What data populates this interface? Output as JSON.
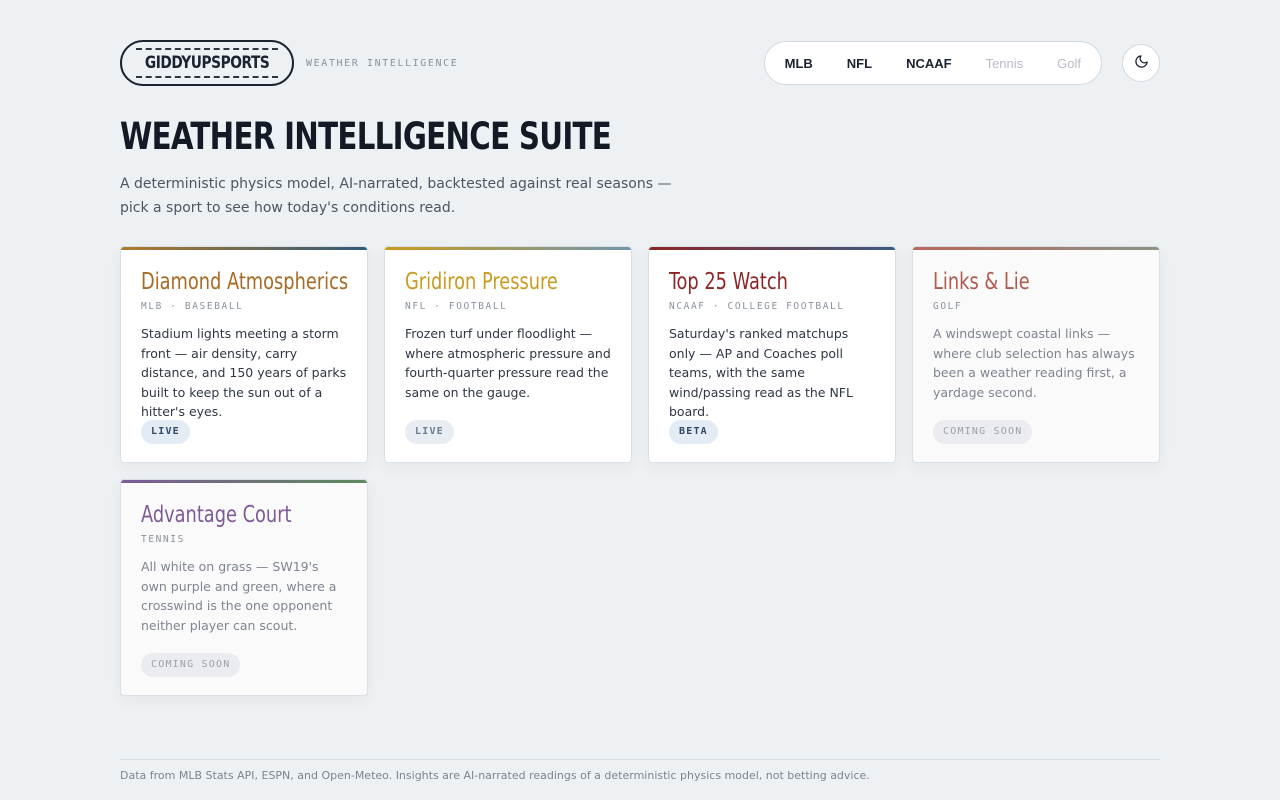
{
  "brand": {
    "logo_text": "GIDDYUPSPORTS",
    "tagline": "WEATHER INTELLIGENCE"
  },
  "nav": {
    "items": [
      {
        "label": "MLB",
        "disabled": false
      },
      {
        "label": "NFL",
        "disabled": false
      },
      {
        "label": "NCAAF",
        "disabled": false
      },
      {
        "label": "Tennis",
        "disabled": true
      },
      {
        "label": "Golf",
        "disabled": true
      }
    ],
    "theme_icon": "moon-icon"
  },
  "hero": {
    "title": "WEATHER INTELLIGENCE SUITE",
    "subtitle": "A deterministic physics model, AI-narrated, backtested against real seasons — pick a sport to see how today's conditions read."
  },
  "cards": [
    {
      "title": "Diamond Atmospherics",
      "meta": "MLB · BASEBALL",
      "description": "Stadium lights meeting a storm front — air density, carry distance, and 150 years of parks built to keep the sun out of a hitter's eyes.",
      "badge": "LIVE",
      "title_color": "#a86a23",
      "accent_from": "#b07a2a",
      "accent_to": "#2f5a7a"
    },
    {
      "title": "Gridiron Pressure",
      "meta": "NFL · FOOTBALL",
      "description": "Frozen turf under floodlight — where atmospheric pressure and fourth-quarter pressure read the same on the gauge.",
      "badge": "LIVE",
      "title_color": "#c99a1e",
      "accent_from": "#c99a1e",
      "accent_to": "#6f97ad"
    },
    {
      "title": "Top 25 Watch",
      "meta": "NCAAF · COLLEGE FOOTBALL",
      "description": "Saturday's ranked matchups only — AP and Coaches poll teams, with the same wind/passing read as the NFL board.",
      "badge": "BETA",
      "title_color": "#8c2626",
      "accent_from": "#8c2626",
      "accent_to": "#3b5b82"
    },
    {
      "title": "Links & Lie",
      "meta": "GOLF",
      "description": "A windswept coastal links — where club selection has always been a weather reading first, a yardage second.",
      "badge": "COMING SOON",
      "title_color": "#b05a4e",
      "accent_from": "#b8665a",
      "accent_to": "#8a9485"
    },
    {
      "title": "Advantage Court",
      "meta": "TENNIS",
      "description": "All white on grass — SW19's own purple and green, where a crosswind is the one opponent neither player can scout.",
      "badge": "COMING SOON",
      "title_color": "#7e5a96",
      "accent_from": "#7e5a96",
      "accent_to": "#5d8a5c"
    }
  ],
  "footer": {
    "text": "Data from MLB Stats API, ESPN, and Open-Meteo. Insights are AI-narrated readings of a deterministic physics model, not betting advice."
  }
}
